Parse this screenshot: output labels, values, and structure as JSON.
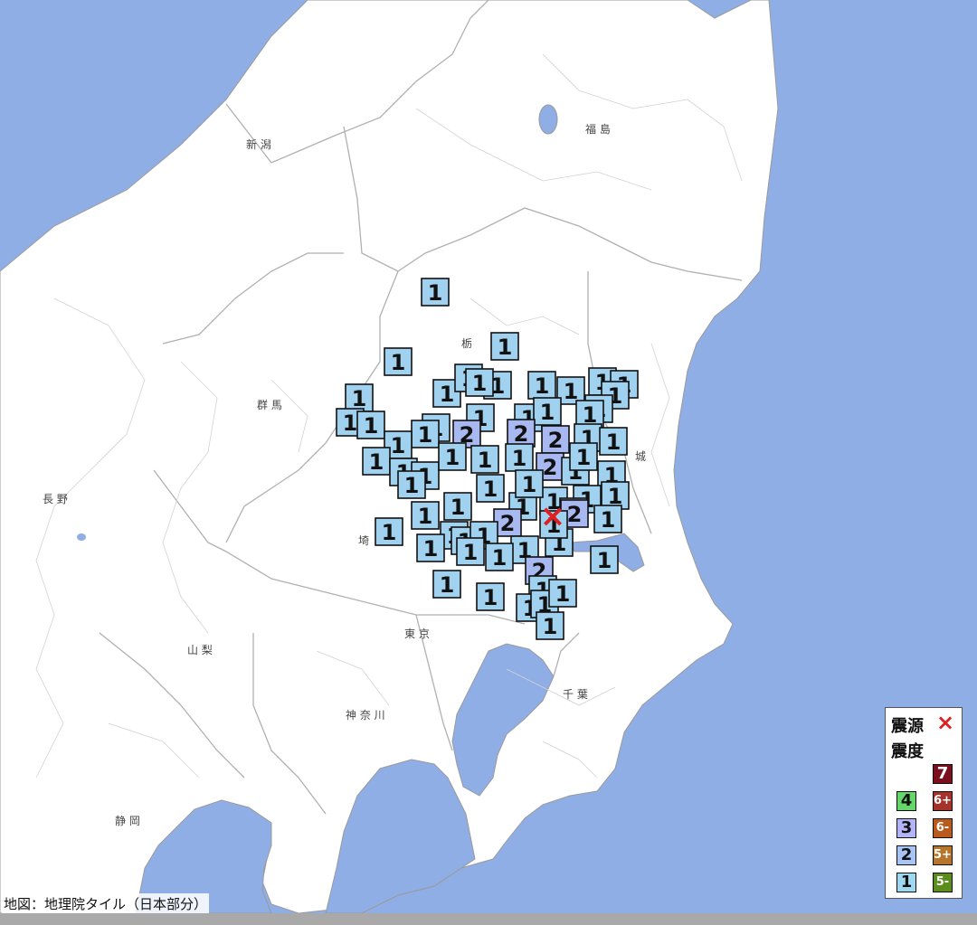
{
  "map": {
    "prefectures": [
      {
        "name": "新 潟"
      },
      {
        "name": "福 島"
      },
      {
        "name": "栃"
      },
      {
        "name": "群 馬"
      },
      {
        "name": "長 野"
      },
      {
        "name": "城"
      },
      {
        "name": "埼"
      },
      {
        "name": "東 京"
      },
      {
        "name": "山 梨"
      },
      {
        "name": "神 奈 川"
      },
      {
        "name": "千 葉"
      },
      {
        "name": "静 岡"
      }
    ],
    "epicenter_symbol": "×",
    "colors": {
      "sea": "#8faee6",
      "land": "#ffffff",
      "intensity_1": "#a0d2f0",
      "intensity_2": "#a8b8f0",
      "intensity_3": "#b4b4ff",
      "intensity_4": "#88d888",
      "epicenter": "#e02020"
    },
    "markers": [
      {
        "v": "1"
      },
      {
        "v": "1"
      },
      {
        "v": "1"
      },
      {
        "v": "1"
      },
      {
        "v": "1"
      },
      {
        "v": "1"
      },
      {
        "v": "1"
      },
      {
        "v": "1"
      },
      {
        "v": "1"
      },
      {
        "v": "1"
      },
      {
        "v": "1"
      },
      {
        "v": "1"
      },
      {
        "v": "1"
      },
      {
        "v": "1"
      },
      {
        "v": "1"
      },
      {
        "v": "1"
      },
      {
        "v": "1"
      },
      {
        "v": "1"
      },
      {
        "v": "1"
      },
      {
        "v": "2"
      },
      {
        "v": "1"
      },
      {
        "v": "1"
      },
      {
        "v": "1"
      },
      {
        "v": "1"
      },
      {
        "v": "2"
      },
      {
        "v": "2"
      },
      {
        "v": "1"
      },
      {
        "v": "1"
      },
      {
        "v": "1"
      },
      {
        "v": "1"
      },
      {
        "v": "1"
      },
      {
        "v": "2"
      },
      {
        "v": "1"
      },
      {
        "v": "1"
      },
      {
        "v": "1"
      },
      {
        "v": "1"
      },
      {
        "v": "1"
      },
      {
        "v": "1"
      },
      {
        "v": "1"
      },
      {
        "v": "1"
      },
      {
        "v": "1"
      },
      {
        "v": "1"
      },
      {
        "v": "1"
      },
      {
        "v": "1"
      },
      {
        "v": "1"
      },
      {
        "v": "1"
      },
      {
        "v": "1"
      },
      {
        "v": "2"
      },
      {
        "v": "1"
      },
      {
        "v": "1"
      },
      {
        "v": "1"
      },
      {
        "v": "1"
      },
      {
        "v": "2"
      },
      {
        "v": "1"
      },
      {
        "v": "1"
      },
      {
        "v": "1"
      },
      {
        "v": "1"
      },
      {
        "v": "1"
      },
      {
        "v": "1"
      },
      {
        "v": "1"
      },
      {
        "v": "1"
      },
      {
        "v": "1"
      },
      {
        "v": "1"
      },
      {
        "v": "2"
      },
      {
        "v": "1"
      },
      {
        "v": "1"
      },
      {
        "v": "1"
      },
      {
        "v": "1"
      },
      {
        "v": "1"
      },
      {
        "v": "1"
      }
    ]
  },
  "legend": {
    "epicenter_label": "震源",
    "epicenter_symbol": "×",
    "intensity_label": "震度",
    "items": [
      {
        "label": "7",
        "color": "#7a0f1e",
        "text": "#ffffff"
      },
      {
        "label": "4",
        "color": "#66d66a",
        "text": "#111111"
      },
      {
        "label": "6+",
        "color": "#a6332b",
        "text": "#ffffff"
      },
      {
        "label": "3",
        "color": "#b4b4f8",
        "text": "#111111"
      },
      {
        "label": "6-",
        "color": "#b85a1e",
        "text": "#ffffff"
      },
      {
        "label": "2",
        "color": "#a8c4f4",
        "text": "#111111"
      },
      {
        "label": "5+",
        "color": "#b5752a",
        "text": "#ffffff"
      },
      {
        "label": "1",
        "color": "#a0d8f0",
        "text": "#111111"
      },
      {
        "label": "5-",
        "color": "#5b8c1e",
        "text": "#ffffff"
      }
    ]
  },
  "credit": "地図：地理院タイル（日本部分）"
}
